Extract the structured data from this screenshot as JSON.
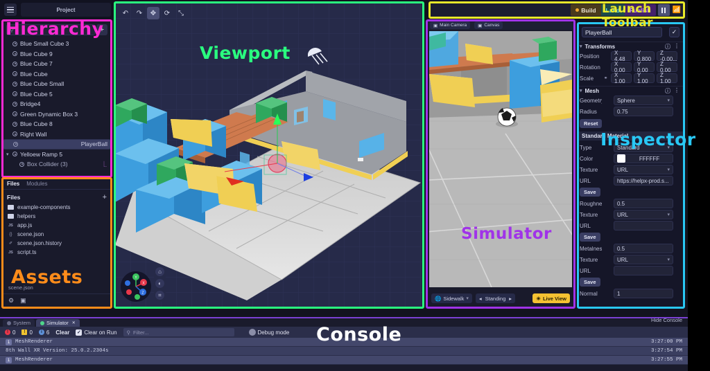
{
  "topbar": {
    "menu_icon": "hamburger-icon",
    "project_label": "Project"
  },
  "hierarchy": {
    "title_overlay": "Hierarchy",
    "overlay_color": "#ff2ad4",
    "search_placeholder": "",
    "add_label": "+",
    "items": [
      {
        "label": "Blue Small Cube 3",
        "selected": false,
        "child": false
      },
      {
        "label": "Blue Cube 9",
        "selected": false,
        "child": false
      },
      {
        "label": "Blue Cube 7",
        "selected": false,
        "child": false
      },
      {
        "label": "Blue Cube",
        "selected": false,
        "child": false
      },
      {
        "label": "Blue Cube Small",
        "selected": false,
        "child": false
      },
      {
        "label": "Blue Cube 5",
        "selected": false,
        "child": false
      },
      {
        "label": "Bridge4",
        "selected": false,
        "child": false
      },
      {
        "label": "Green Dynamic Box 3",
        "selected": false,
        "child": false
      },
      {
        "label": "Blue Cube 8",
        "selected": false,
        "child": false
      },
      {
        "label": "Right Wall",
        "selected": false,
        "child": false
      },
      {
        "label": "PlayerBall",
        "selected": true,
        "child": false
      },
      {
        "label": "Yelloew Ramp 5",
        "selected": false,
        "child": false,
        "expanded": true
      },
      {
        "label": "Box Collider (3)",
        "selected": false,
        "child": true
      }
    ]
  },
  "files": {
    "overlay_title": "Assets",
    "overlay_color": "#ff8c1a",
    "tabs": [
      {
        "label": "Files",
        "active": true
      },
      {
        "label": "Modules",
        "active": false
      }
    ],
    "section_label": "Files",
    "add_label": "+",
    "items": [
      {
        "label": "example-components",
        "icon": "folder-icon"
      },
      {
        "label": "helpers",
        "icon": "folder-icon"
      },
      {
        "label": "app.js",
        "icon": "js-icon"
      },
      {
        "label": "scene.json",
        "icon": "json-icon"
      },
      {
        "label": "scene.json.history",
        "icon": "file-icon"
      },
      {
        "label": "script.ts",
        "icon": "js-icon"
      }
    ],
    "footer_path": "scene.json",
    "footer_icons": [
      "settings-icon",
      "panel-icon"
    ]
  },
  "viewport": {
    "overlay_title": "Viewport",
    "overlay_color": "#2aff7f",
    "tools": [
      {
        "name": "undo-button",
        "glyph": "↶",
        "active": false
      },
      {
        "name": "redo-button",
        "glyph": "↷",
        "active": false
      },
      {
        "name": "move-tool-button",
        "glyph": "✥",
        "active": true
      },
      {
        "name": "rotate-tool-button",
        "glyph": "⟳",
        "active": false
      },
      {
        "name": "scale-tool-button",
        "glyph": "⤡",
        "active": false
      }
    ],
    "gizmo_axes": [
      {
        "label": "X",
        "color": "#e8374a"
      },
      {
        "label": "Y",
        "color": "#3ac45e"
      },
      {
        "label": "Z",
        "color": "#2f6fe0"
      }
    ],
    "gizmo_buttons": [
      {
        "name": "home-view-button",
        "glyph": "⌂"
      },
      {
        "name": "lighting-button",
        "glyph": "◐"
      },
      {
        "name": "grid-button",
        "glyph": "⌗"
      }
    ],
    "light_gizmo": "directional-light-icon"
  },
  "simulator": {
    "overlay_title": "Simulator",
    "overlay_color": "#a033e8",
    "header_items": [
      "Main Camera",
      "Canvas"
    ],
    "footer": {
      "environment": "Sidewalk",
      "pose": "Standing",
      "prev_label": "◂",
      "next_label": "▸",
      "live_view": "Live View"
    }
  },
  "launch_toolbar": {
    "overlay_title": "Launch Toolbar",
    "overlay_color": "#e8e82a",
    "buttons": [
      {
        "label": "Build",
        "name": "build-button"
      },
      {
        "label": "Land",
        "name": "land-button"
      },
      {
        "label": "Publish",
        "name": "publish-button"
      }
    ],
    "pause_name": "pause-button",
    "cast_name": "cast-icon"
  },
  "inspector": {
    "overlay_title": "Inspector",
    "overlay_color": "#29c8f5",
    "object_name": "PlayerBall",
    "enabled_check": "✓",
    "sections": [
      {
        "title": "Transforms",
        "rows": [
          {
            "label": "Position",
            "x": "X 4.48",
            "y": "Y 0.800",
            "z": "Z -0.00..."
          },
          {
            "label": "Rotation",
            "x": "X 0.00",
            "y": "Y 0.00",
            "z": "Z 0.00"
          },
          {
            "label": "Scale",
            "x": "X 1.00",
            "y": "Y 1.00",
            "z": "Z 1.00",
            "link": true
          }
        ]
      }
    ],
    "mesh": {
      "title": "Mesh",
      "geometry_label": "Geometry",
      "geometry_value": "Sphere",
      "radius_label": "Radius",
      "radius_value": "0.75",
      "reset_label": "Reset"
    },
    "material": {
      "header": "Standard Material",
      "type_label": "Type",
      "type_value": "Standard",
      "color_label": "Color",
      "color_value": "FFFFFF",
      "color_hex": "#FFFFFF",
      "fields": [
        {
          "label": "Texture",
          "value": "URL",
          "kind": "select"
        },
        {
          "label": "URL",
          "value": "https://helpx-prod.s...",
          "kind": "input"
        },
        {
          "label": "Save",
          "kind": "button"
        },
        {
          "label": "Roughness",
          "value": "0.5",
          "kind": "input"
        },
        {
          "label": "Texture",
          "value": "URL",
          "kind": "select"
        },
        {
          "label": "URL",
          "value": "",
          "kind": "input"
        },
        {
          "label": "Save",
          "kind": "button"
        },
        {
          "label": "Metalness",
          "value": "0.5",
          "kind": "input"
        },
        {
          "label": "Texture",
          "value": "URL",
          "kind": "select"
        },
        {
          "label": "URL",
          "value": "",
          "kind": "input"
        },
        {
          "label": "Save",
          "kind": "button"
        },
        {
          "label": "Normal",
          "value": "1",
          "kind": "input"
        }
      ]
    }
  },
  "console": {
    "overlay_title": "Console",
    "overlay_color": "#ffffff",
    "tabs": [
      {
        "label": "System",
        "active": false
      },
      {
        "label": "Simulator",
        "active": true
      }
    ],
    "hide_label": "Hide Console",
    "errors": "0",
    "warnings": "0",
    "infos": "6",
    "clear_label": "Clear",
    "clear_on_run_label": "Clear on Run",
    "clear_on_run_checked": true,
    "filter_placeholder": "Filter...",
    "debug_mode_label": "Debug mode",
    "debug_mode_on": false,
    "logs": [
      {
        "text": "MeshRenderer",
        "time": "3:27:00 PM",
        "badge": "i"
      },
      {
        "text": "8th Wall XR Version: 25.0.2.2304s",
        "time": "3:27:54 PM",
        "badge": ""
      },
      {
        "text": "MeshRenderer",
        "time": "3:27:55 PM",
        "badge": "i"
      }
    ]
  }
}
